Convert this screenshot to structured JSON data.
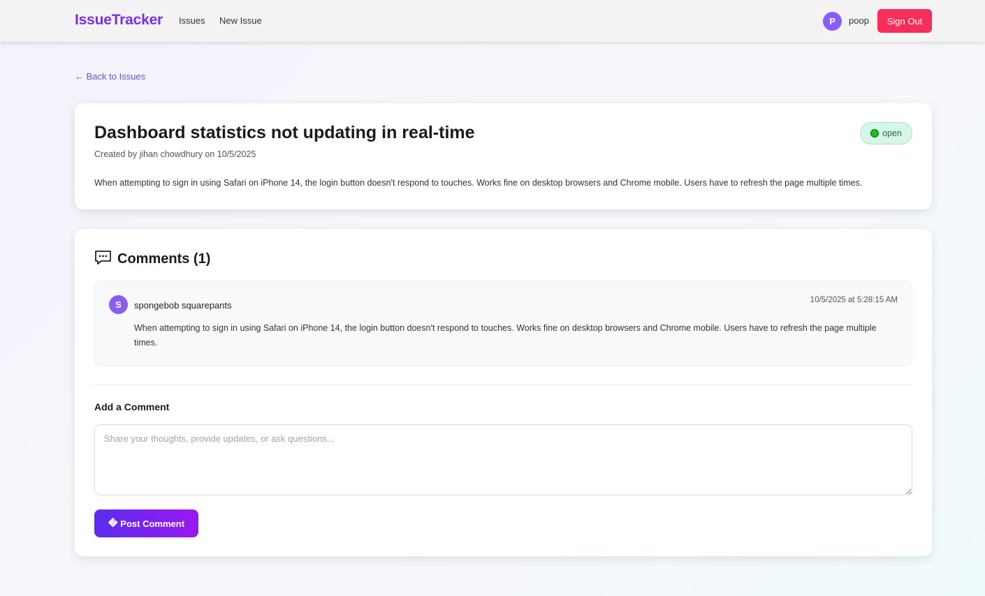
{
  "header": {
    "brand": "IssueTracker",
    "nav": {
      "issues": "Issues",
      "new_issue": "New Issue"
    },
    "user": {
      "initial": "P",
      "name": "poop"
    },
    "sign_out": "Sign Out"
  },
  "back_link": "← Back to Issues",
  "issue": {
    "title": "Dashboard statistics not updating in real-time",
    "meta": "Created by jihan chowdhury on 10/5/2025",
    "status": "open",
    "description": "When attempting to sign in using Safari on iPhone 14, the login button doesn't respond to touches. Works fine on desktop browsers and Chrome mobile. Users have to refresh the page multiple times."
  },
  "comments": {
    "heading": "Comments (1)",
    "icon": "chat-bubble-icon",
    "items": [
      {
        "initial": "S",
        "author": "spongebob squarepants",
        "time": "10/5/2025 at 5:28:15 AM",
        "text": "When attempting to sign in using Safari on iPhone 14, the login button doesn't respond to touches. Works fine on desktop browsers and Chrome mobile. Users have to refresh the page multiple times."
      }
    ],
    "add_label": "Add a Comment",
    "placeholder": "Share your thoughts, provide updates, or ask questions...",
    "post_icon": "�",
    "post_label": "Post Comment"
  },
  "colors": {
    "brand": "#7c2ee8",
    "sign_out": "#f72d5b",
    "avatar": "#8b5cf6",
    "status_open": "#16c216"
  }
}
